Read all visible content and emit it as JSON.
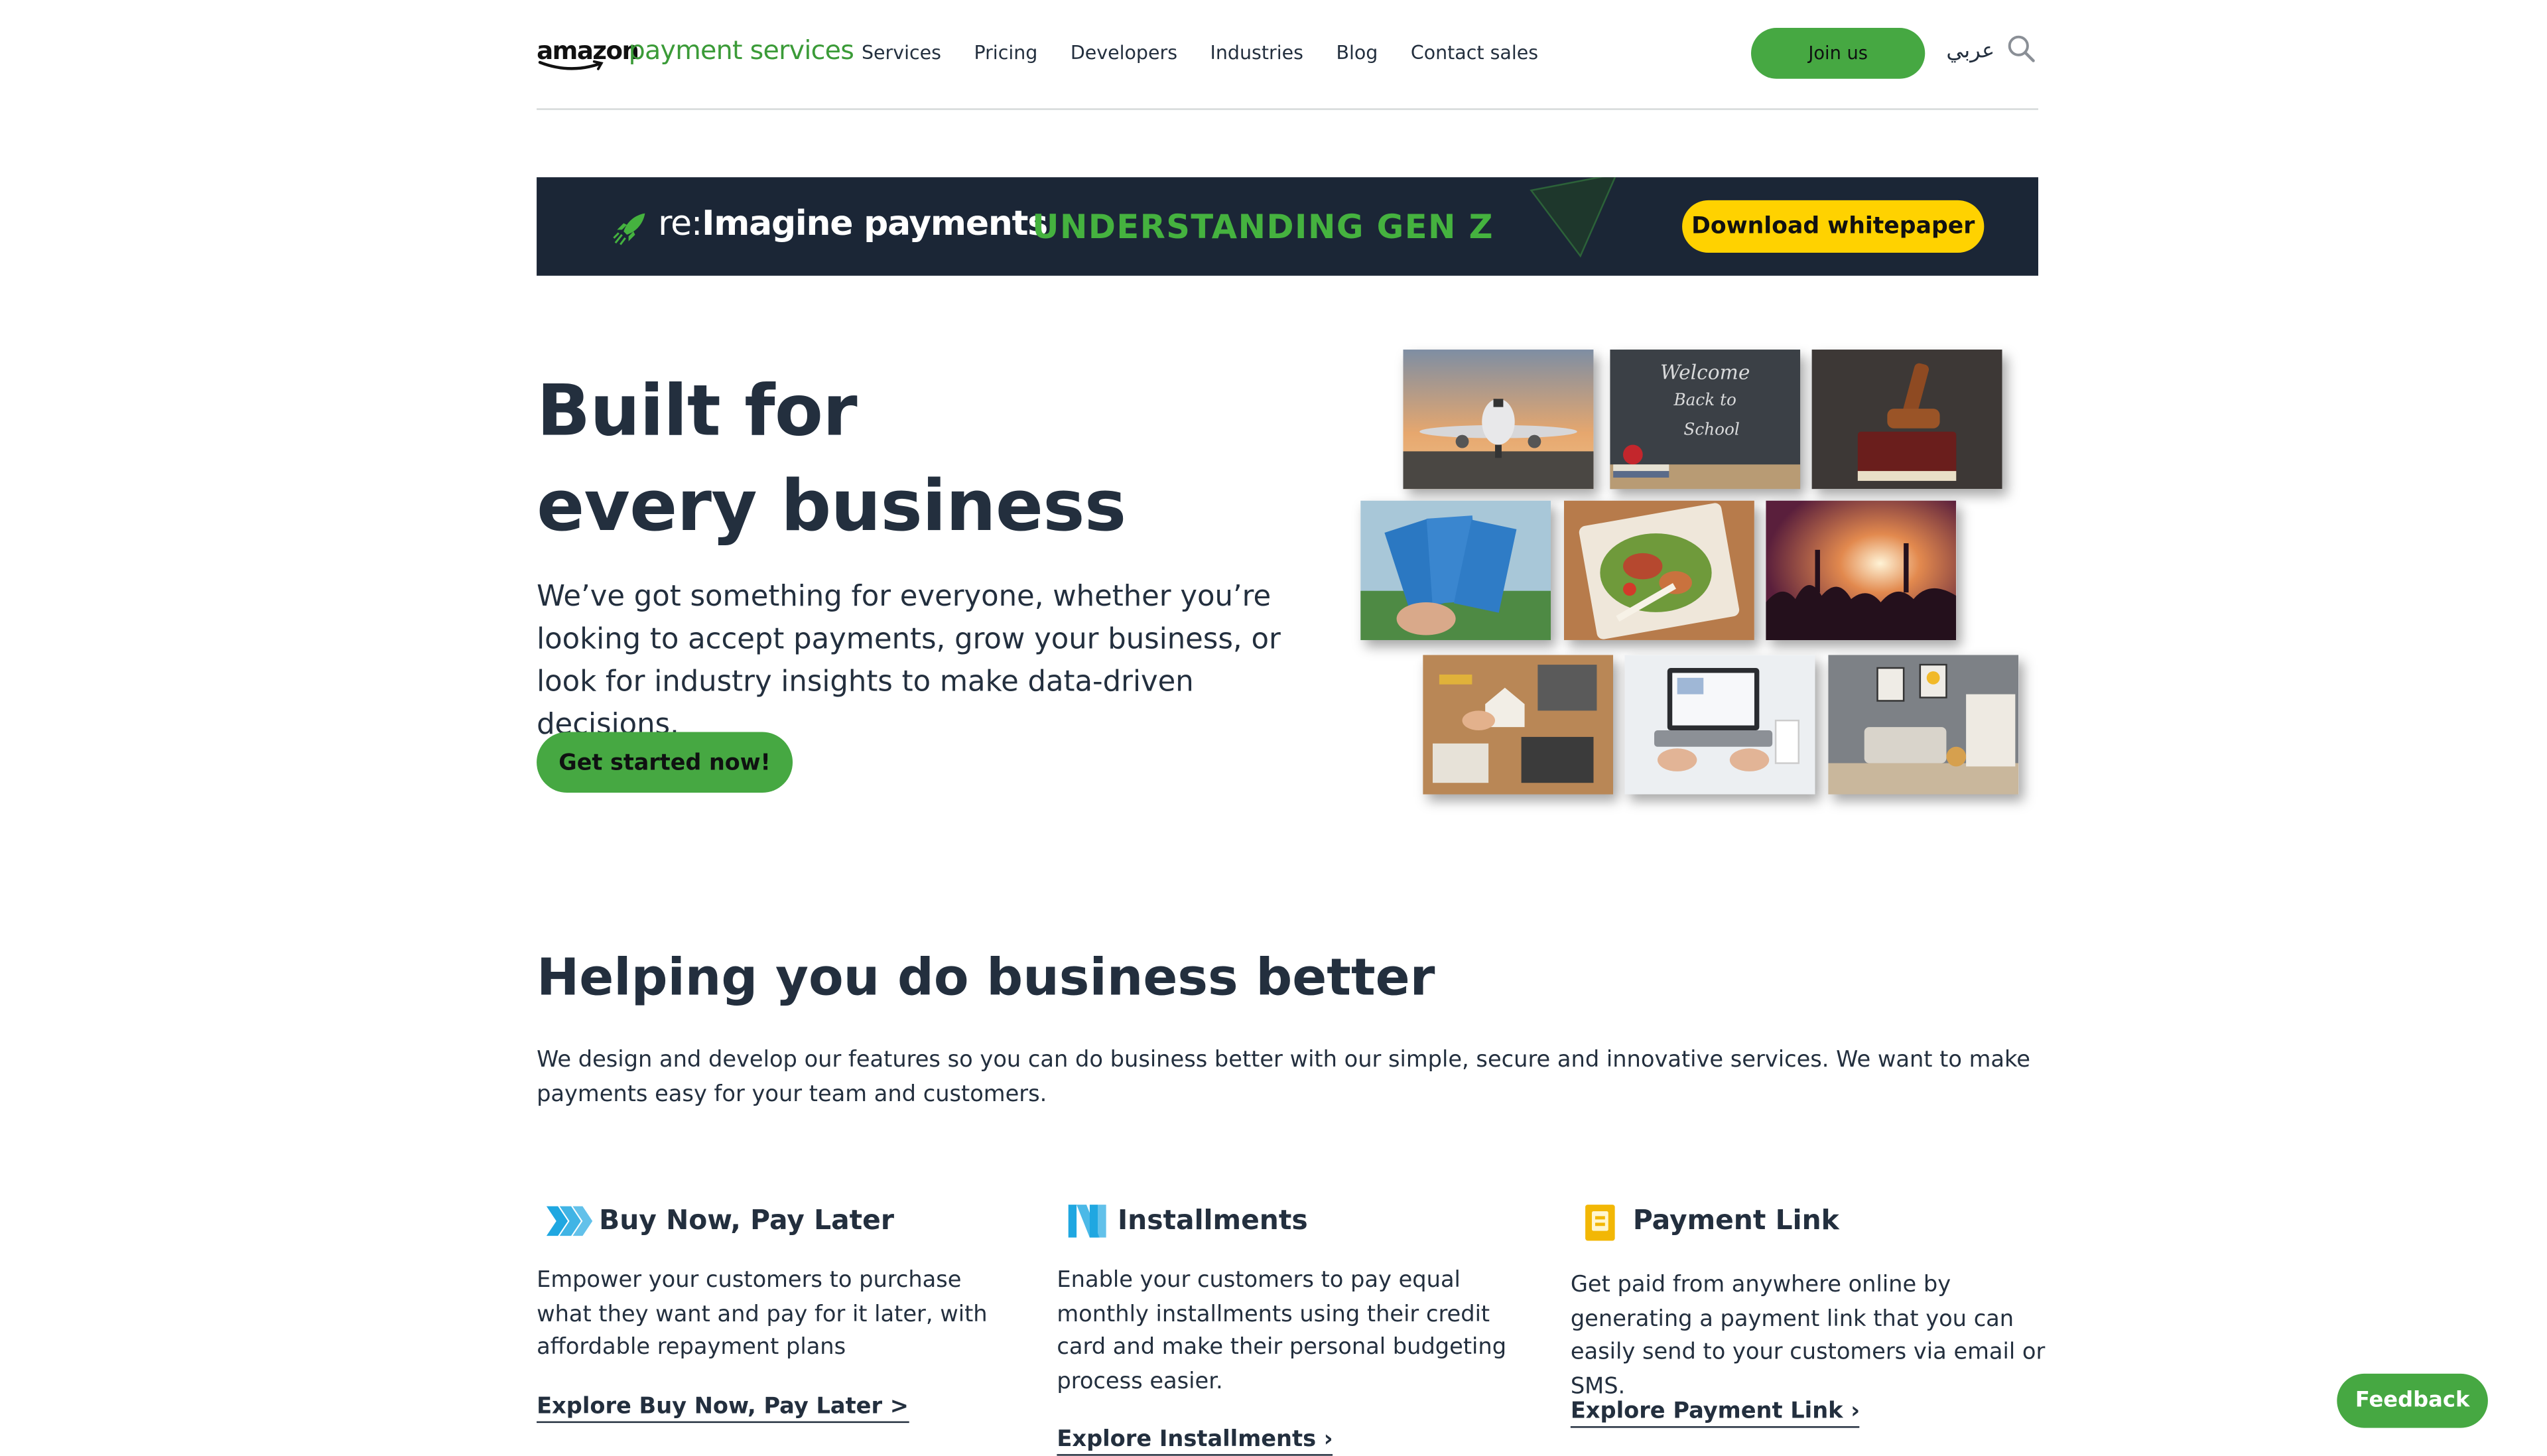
{
  "header": {
    "logo_amazon": "amazon",
    "logo_service": "payment services",
    "nav": [
      "Services",
      "Pricing",
      "Developers",
      "Industries",
      "Blog",
      "Contact sales"
    ],
    "join_label": "Join us",
    "language_label": "عربي",
    "search_icon": "search-icon"
  },
  "banner": {
    "prefix": "re:",
    "brand": "Imagine payments",
    "headline": "UNDERSTANDING GEN Z",
    "cta": "Download whitepaper"
  },
  "hero": {
    "title_line1": "Built for",
    "title_line2": "every business",
    "description": "We’ve got something for everyone, whether you’re looking to accept payments, grow your business, or look for industry insights to make data-driven decisions.",
    "cta": "Get started now!",
    "chalkboard_text": [
      "Welcome",
      "Back to",
      "School"
    ]
  },
  "section": {
    "title": "Helping you do business better",
    "description": "We design and develop our features so you can do business better with our simple, secure and innovative services. We want to make payments easy for your team and customers."
  },
  "features": [
    {
      "icon": "bnpl-icon",
      "name": "Buy Now, Pay Later",
      "description": "Empower your customers to purchase what they want and pay for it later, with affordable repayment plans",
      "link": "Explore Buy Now, Pay Later >"
    },
    {
      "icon": "installments-icon",
      "name": "Installments",
      "description": "Enable your customers to pay equal monthly installments using their credit card and make their personal budgeting process easier.",
      "link": "Explore Installments ›"
    },
    {
      "icon": "payment-link-icon",
      "name": "Payment Link",
      "description": "Get paid from anywhere online by generating a payment link that you can easily send to your customers via email or SMS.",
      "link": "Explore Payment Link ›"
    }
  ],
  "feedback_label": "Feedback",
  "colors": {
    "brand_green": "#46a842",
    "banner_bg": "#1b2636",
    "banner_accent": "#45b23f",
    "banner_cta": "#ffd200",
    "text": "#232f3e",
    "icon_blue": "#1fa7e1",
    "icon_yellow": "#f2b705"
  }
}
